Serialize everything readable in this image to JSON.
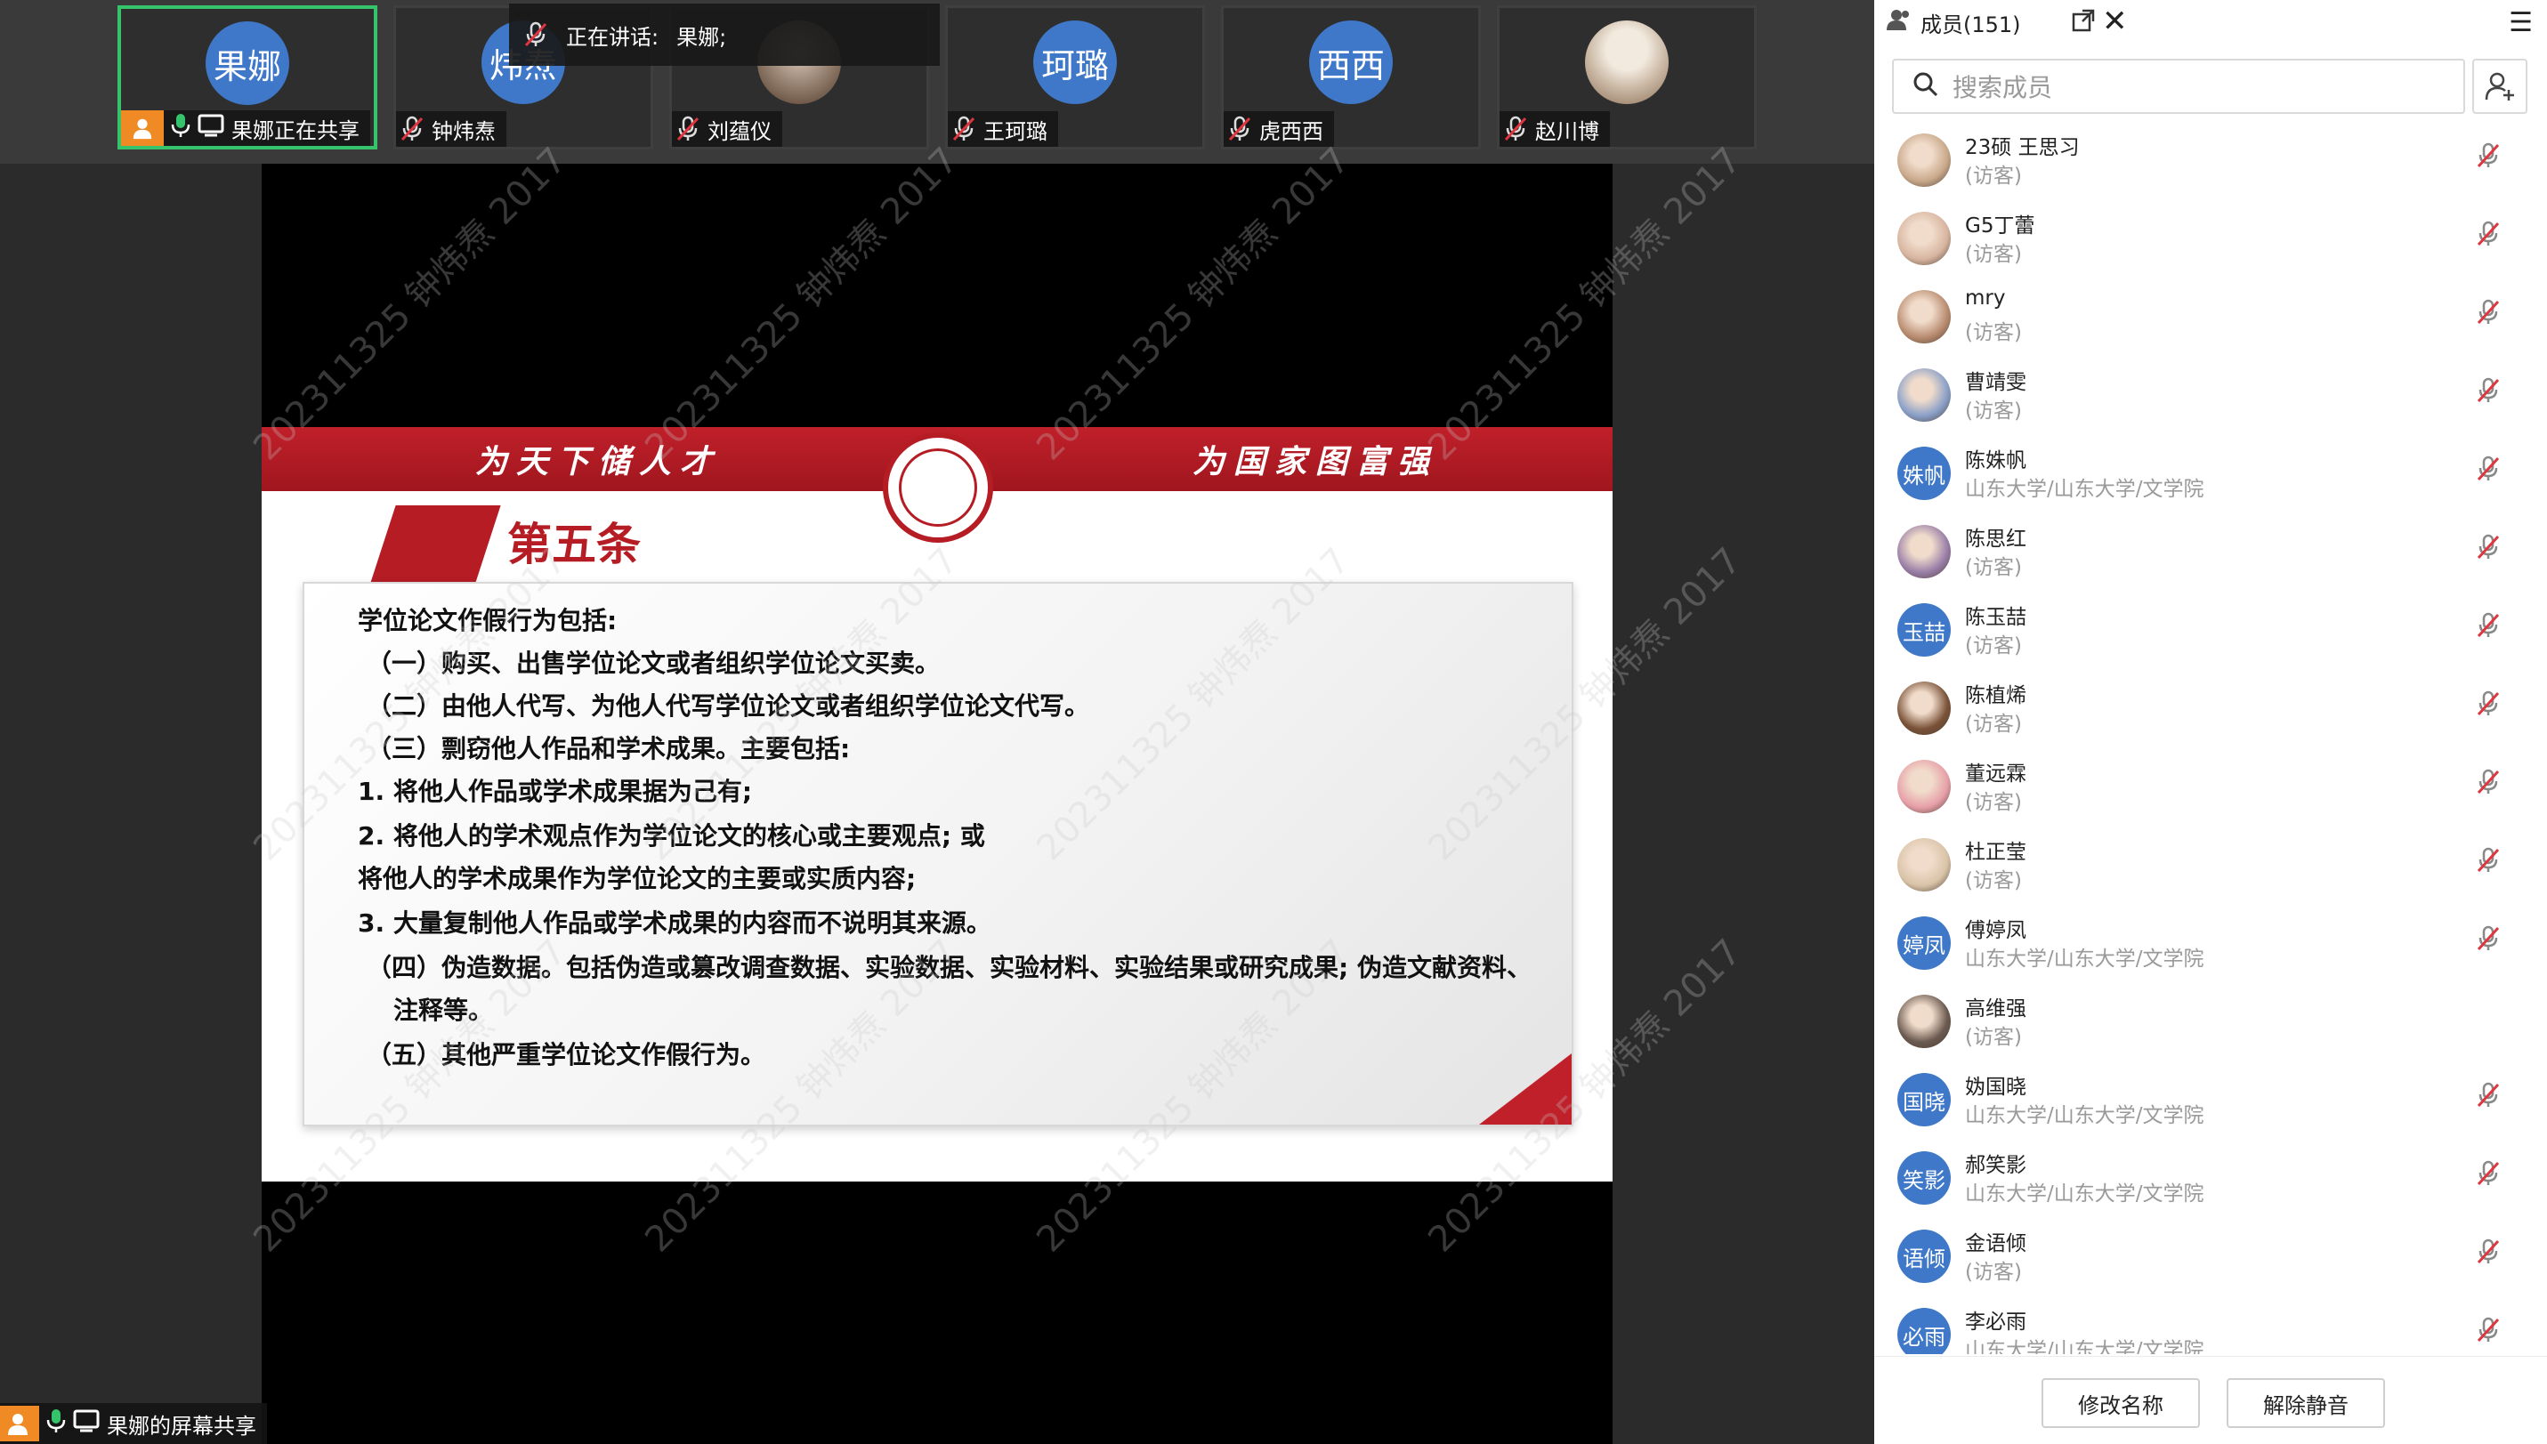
{
  "colors": {
    "active_border": "#35c46b",
    "avatar_blue": "#3f78c9",
    "share_orange": "#f08a24",
    "slide_red": "#b51c24"
  },
  "video_tiles": [
    {
      "avatar_text": "果娜",
      "name": "果娜正在共享",
      "active": true,
      "sharing": true
    },
    {
      "avatar_text": "炜焘",
      "name": "钟炜焘"
    },
    {
      "avatar_text": "",
      "name": "刘蕴仪",
      "photo": true
    },
    {
      "avatar_text": "珂璐",
      "name": "王珂璐"
    },
    {
      "avatar_text": "西西",
      "name": "虎西西"
    },
    {
      "avatar_text": "",
      "name": "赵川博",
      "photo": true
    }
  ],
  "speaking": {
    "label": "正在讲话:",
    "name": "果娜;"
  },
  "slide": {
    "banner_left": "为天下储人才",
    "banner_right": "为国家图富强",
    "title": "第五条",
    "lines": [
      "学位论文作假行为包括:",
      "（一）购买、出售学位论文或者组织学位论文买卖。",
      "（二）由他人代写、为他人代写学位论文或者组织学位论文代写。",
      "（三）剽窃他人作品和学术成果。主要包括:",
      "1. 将他人作品或学术成果据为己有;",
      "2. 将他人的学术观点作为学位论文的核心或主要观点; 或",
      "将他人的学术成果作为学位论文的主要或实质内容;",
      "3. 大量复制他人作品或学术成果的内容而不说明其来源。",
      "（四）伪造数据。包括伪造或篡改调查数据、实验数据、实验材料、实验结果或研究成果; 伪造文献资料、",
      "注释等。",
      "（五）其他严重学位论文作假行为。"
    ],
    "watermark": "202311325 钟炜焘 2017"
  },
  "screenshare_label": "果娜的屏幕共享",
  "panel": {
    "title": "成员(151)",
    "search_placeholder": "搜索成员",
    "members": [
      {
        "name": "23硕 王思习",
        "sub": "(访客)",
        "avatar": "",
        "photo": true
      },
      {
        "name": "G5丁蕾",
        "sub": "(访客)",
        "avatar": "",
        "photo": true
      },
      {
        "name": "mry",
        "sub": "(访客)",
        "avatar": "",
        "photo": true
      },
      {
        "name": "曹靖雯",
        "sub": "(访客)",
        "avatar": "",
        "photo": true
      },
      {
        "name": "陈姝帆",
        "sub": "山东大学/山东大学/文学院",
        "avatar": "姝帆"
      },
      {
        "name": "陈思红",
        "sub": "(访客)",
        "avatar": "",
        "photo": true
      },
      {
        "name": "陈玉喆",
        "sub": "(访客)",
        "avatar": "玉喆"
      },
      {
        "name": "陈植烯",
        "sub": "(访客)",
        "avatar": "",
        "photo": true
      },
      {
        "name": "董远霖",
        "sub": "(访客)",
        "avatar": "",
        "photo": true
      },
      {
        "name": "杜正莹",
        "sub": "(访客)",
        "avatar": "",
        "photo": true
      },
      {
        "name": "傅婷凤",
        "sub": "山东大学/山东大学/文学院",
        "avatar": "婷凤"
      },
      {
        "name": "高维强",
        "sub": "(访客)",
        "avatar": "",
        "photo": true,
        "nomic": true
      },
      {
        "name": "妫国晓",
        "sub": "山东大学/山东大学/文学院",
        "avatar": "国晓"
      },
      {
        "name": "郝笑影",
        "sub": "山东大学/山东大学/文学院",
        "avatar": "笑影"
      },
      {
        "name": "金语倾",
        "sub": "(访客)",
        "avatar": "语倾"
      },
      {
        "name": "李必雨",
        "sub": "山东大学/山东大学/文学院",
        "avatar": "必雨"
      }
    ],
    "rename_button": "修改名称",
    "unmute_button": "解除静音"
  }
}
